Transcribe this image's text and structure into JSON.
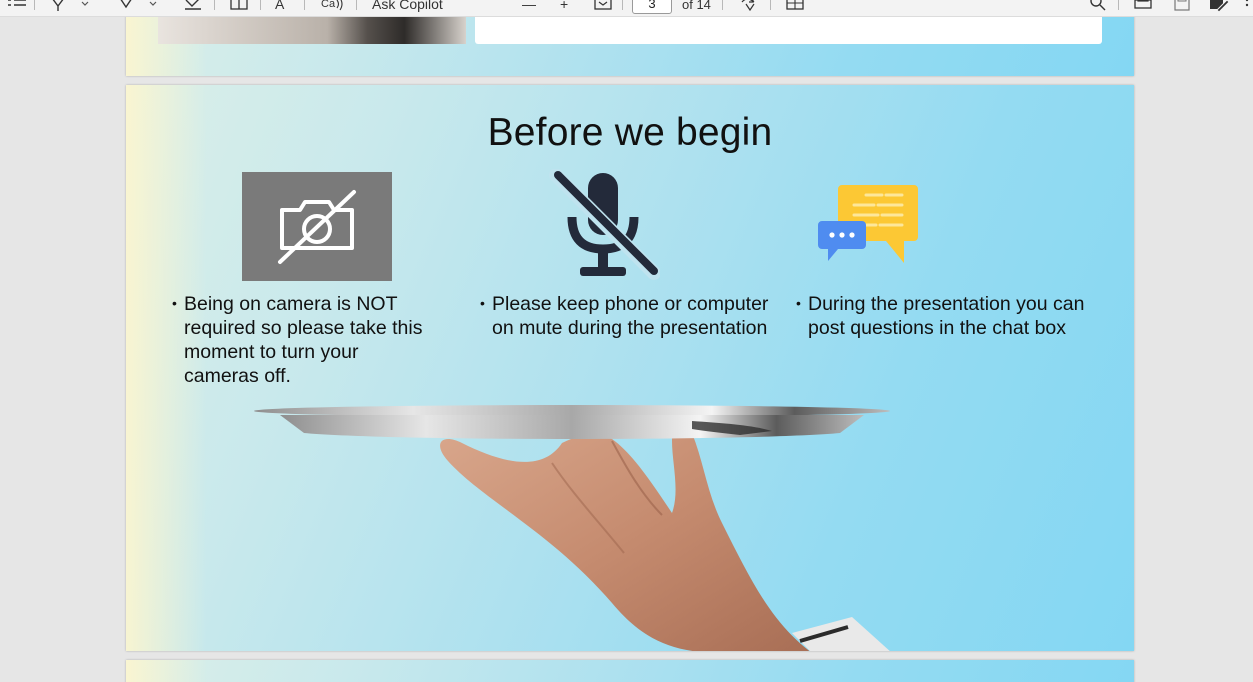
{
  "toolbar": {
    "ask_copilot": "Ask Copilot",
    "current_page": "3",
    "page_count": "of 14",
    "text_tool": "A",
    "minus": "—",
    "plus": "+"
  },
  "slide": {
    "title": "Before we begin",
    "bullets": [
      "Being on camera is NOT required so please take this moment to turn your cameras off.",
      "Please keep phone or computer on mute during the presentation",
      "During the presentation you can post questions in the chat box"
    ]
  },
  "colors": {
    "camera_tile": "#7a7a7a",
    "mic_icon": "#232a3a",
    "chat_yellow": "#fcc834",
    "chat_blue": "#4f8cf0"
  },
  "icons": {
    "camera": "camera-off-icon",
    "mic": "mic-off-icon",
    "chat": "chat-bubbles-icon"
  }
}
